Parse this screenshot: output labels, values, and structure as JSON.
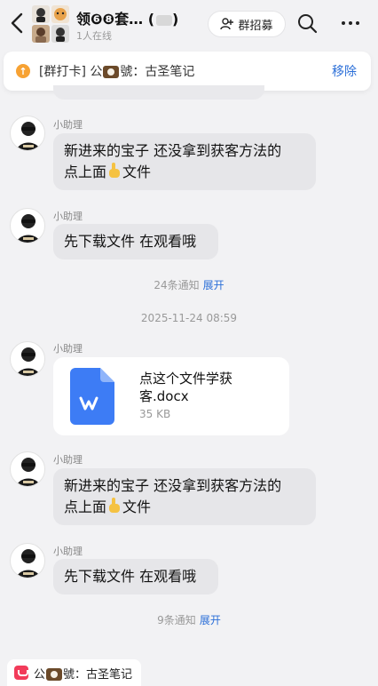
{
  "header": {
    "title": "领❻❽套…",
    "title_paren_open": "(",
    "title_paren_close": ")",
    "online": "1人在线",
    "recruit_label": "群招募"
  },
  "pinned": {
    "prefix": "[群打卡] 公",
    "suffix": "號：古圣笔记",
    "remove": "移除"
  },
  "messages": [
    {
      "sender": "小助理",
      "line1": "新进来的宝子 还没拿到获客方法的",
      "line2_a": "点上面",
      "line2_b": "文件"
    },
    {
      "sender": "小助理",
      "text": "先下载文件 在观看哦"
    },
    {
      "notice_count": "24条通知",
      "notice_link": "展开"
    },
    {
      "timestamp": "2025-11-24 08:59"
    },
    {
      "sender": "小助理",
      "file": {
        "name_line1": "点这个文件学获",
        "name_line2": "客.docx",
        "size": "35 KB"
      }
    },
    {
      "sender": "小助理",
      "line1": "新进来的宝子 还没拿到获客方法的",
      "line2_a": "点上面",
      "line2_b": "文件"
    },
    {
      "sender": "小助理",
      "text": "先下载文件 在观看哦"
    },
    {
      "notice_count": "9条通知",
      "notice_link": "展开"
    }
  ],
  "bottom_chip": {
    "prefix": "公",
    "suffix": "號：古圣笔记"
  },
  "colors": {
    "accent_link": "#2b6fd8",
    "pin_icon": "#f7a233",
    "doc_icon": "#3d7cf5",
    "chip_icon": "#f23b5a"
  }
}
